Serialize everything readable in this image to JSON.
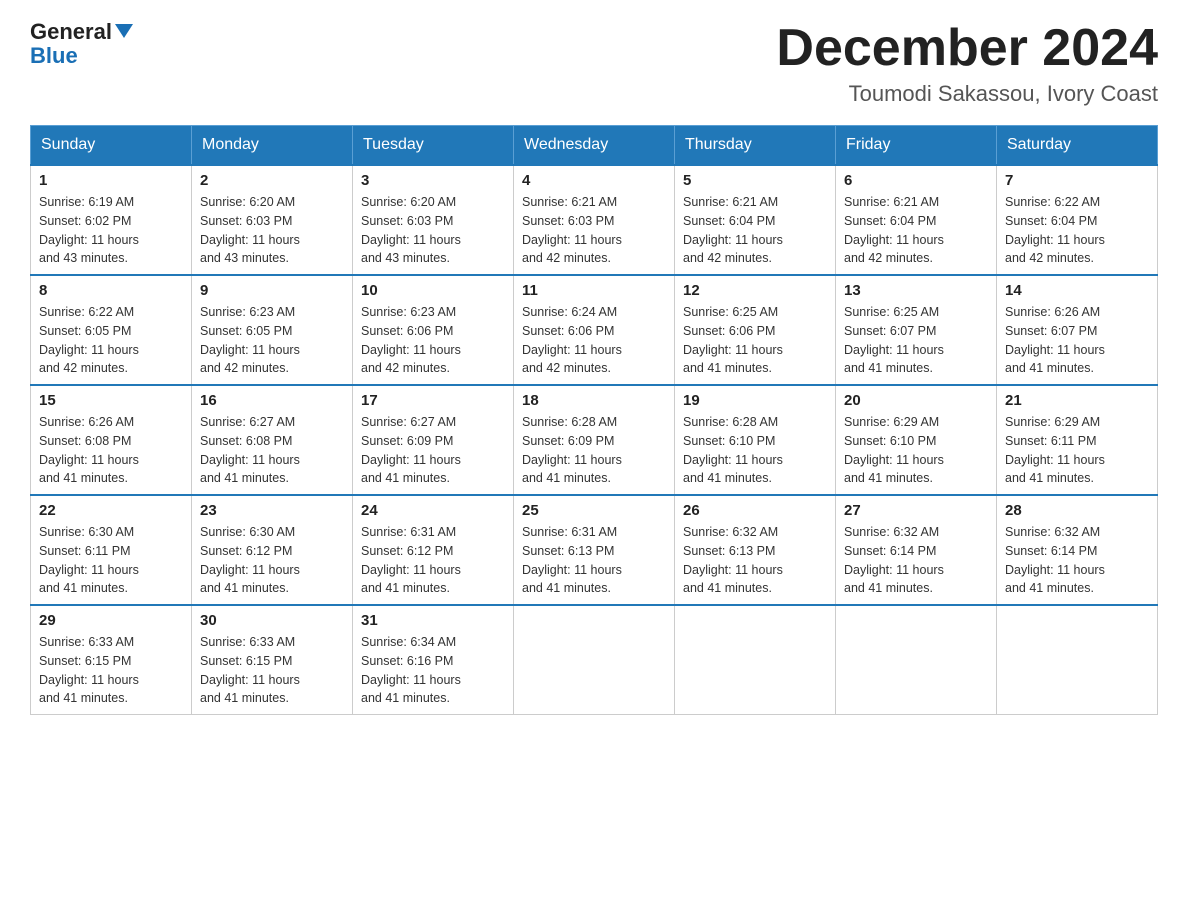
{
  "header": {
    "logo_general": "General",
    "logo_blue": "Blue",
    "main_title": "December 2024",
    "subtitle": "Toumodi Sakassou, Ivory Coast"
  },
  "days_of_week": [
    "Sunday",
    "Monday",
    "Tuesday",
    "Wednesday",
    "Thursday",
    "Friday",
    "Saturday"
  ],
  "weeks": [
    [
      {
        "day": "1",
        "sunrise": "6:19 AM",
        "sunset": "6:02 PM",
        "daylight": "11 hours and 43 minutes."
      },
      {
        "day": "2",
        "sunrise": "6:20 AM",
        "sunset": "6:03 PM",
        "daylight": "11 hours and 43 minutes."
      },
      {
        "day": "3",
        "sunrise": "6:20 AM",
        "sunset": "6:03 PM",
        "daylight": "11 hours and 43 minutes."
      },
      {
        "day": "4",
        "sunrise": "6:21 AM",
        "sunset": "6:03 PM",
        "daylight": "11 hours and 42 minutes."
      },
      {
        "day": "5",
        "sunrise": "6:21 AM",
        "sunset": "6:04 PM",
        "daylight": "11 hours and 42 minutes."
      },
      {
        "day": "6",
        "sunrise": "6:21 AM",
        "sunset": "6:04 PM",
        "daylight": "11 hours and 42 minutes."
      },
      {
        "day": "7",
        "sunrise": "6:22 AM",
        "sunset": "6:04 PM",
        "daylight": "11 hours and 42 minutes."
      }
    ],
    [
      {
        "day": "8",
        "sunrise": "6:22 AM",
        "sunset": "6:05 PM",
        "daylight": "11 hours and 42 minutes."
      },
      {
        "day": "9",
        "sunrise": "6:23 AM",
        "sunset": "6:05 PM",
        "daylight": "11 hours and 42 minutes."
      },
      {
        "day": "10",
        "sunrise": "6:23 AM",
        "sunset": "6:06 PM",
        "daylight": "11 hours and 42 minutes."
      },
      {
        "day": "11",
        "sunrise": "6:24 AM",
        "sunset": "6:06 PM",
        "daylight": "11 hours and 42 minutes."
      },
      {
        "day": "12",
        "sunrise": "6:25 AM",
        "sunset": "6:06 PM",
        "daylight": "11 hours and 41 minutes."
      },
      {
        "day": "13",
        "sunrise": "6:25 AM",
        "sunset": "6:07 PM",
        "daylight": "11 hours and 41 minutes."
      },
      {
        "day": "14",
        "sunrise": "6:26 AM",
        "sunset": "6:07 PM",
        "daylight": "11 hours and 41 minutes."
      }
    ],
    [
      {
        "day": "15",
        "sunrise": "6:26 AM",
        "sunset": "6:08 PM",
        "daylight": "11 hours and 41 minutes."
      },
      {
        "day": "16",
        "sunrise": "6:27 AM",
        "sunset": "6:08 PM",
        "daylight": "11 hours and 41 minutes."
      },
      {
        "day": "17",
        "sunrise": "6:27 AM",
        "sunset": "6:09 PM",
        "daylight": "11 hours and 41 minutes."
      },
      {
        "day": "18",
        "sunrise": "6:28 AM",
        "sunset": "6:09 PM",
        "daylight": "11 hours and 41 minutes."
      },
      {
        "day": "19",
        "sunrise": "6:28 AM",
        "sunset": "6:10 PM",
        "daylight": "11 hours and 41 minutes."
      },
      {
        "day": "20",
        "sunrise": "6:29 AM",
        "sunset": "6:10 PM",
        "daylight": "11 hours and 41 minutes."
      },
      {
        "day": "21",
        "sunrise": "6:29 AM",
        "sunset": "6:11 PM",
        "daylight": "11 hours and 41 minutes."
      }
    ],
    [
      {
        "day": "22",
        "sunrise": "6:30 AM",
        "sunset": "6:11 PM",
        "daylight": "11 hours and 41 minutes."
      },
      {
        "day": "23",
        "sunrise": "6:30 AM",
        "sunset": "6:12 PM",
        "daylight": "11 hours and 41 minutes."
      },
      {
        "day": "24",
        "sunrise": "6:31 AM",
        "sunset": "6:12 PM",
        "daylight": "11 hours and 41 minutes."
      },
      {
        "day": "25",
        "sunrise": "6:31 AM",
        "sunset": "6:13 PM",
        "daylight": "11 hours and 41 minutes."
      },
      {
        "day": "26",
        "sunrise": "6:32 AM",
        "sunset": "6:13 PM",
        "daylight": "11 hours and 41 minutes."
      },
      {
        "day": "27",
        "sunrise": "6:32 AM",
        "sunset": "6:14 PM",
        "daylight": "11 hours and 41 minutes."
      },
      {
        "day": "28",
        "sunrise": "6:32 AM",
        "sunset": "6:14 PM",
        "daylight": "11 hours and 41 minutes."
      }
    ],
    [
      {
        "day": "29",
        "sunrise": "6:33 AM",
        "sunset": "6:15 PM",
        "daylight": "11 hours and 41 minutes."
      },
      {
        "day": "30",
        "sunrise": "6:33 AM",
        "sunset": "6:15 PM",
        "daylight": "11 hours and 41 minutes."
      },
      {
        "day": "31",
        "sunrise": "6:34 AM",
        "sunset": "6:16 PM",
        "daylight": "11 hours and 41 minutes."
      },
      null,
      null,
      null,
      null
    ]
  ],
  "labels": {
    "sunrise": "Sunrise:",
    "sunset": "Sunset:",
    "daylight": "Daylight:"
  }
}
